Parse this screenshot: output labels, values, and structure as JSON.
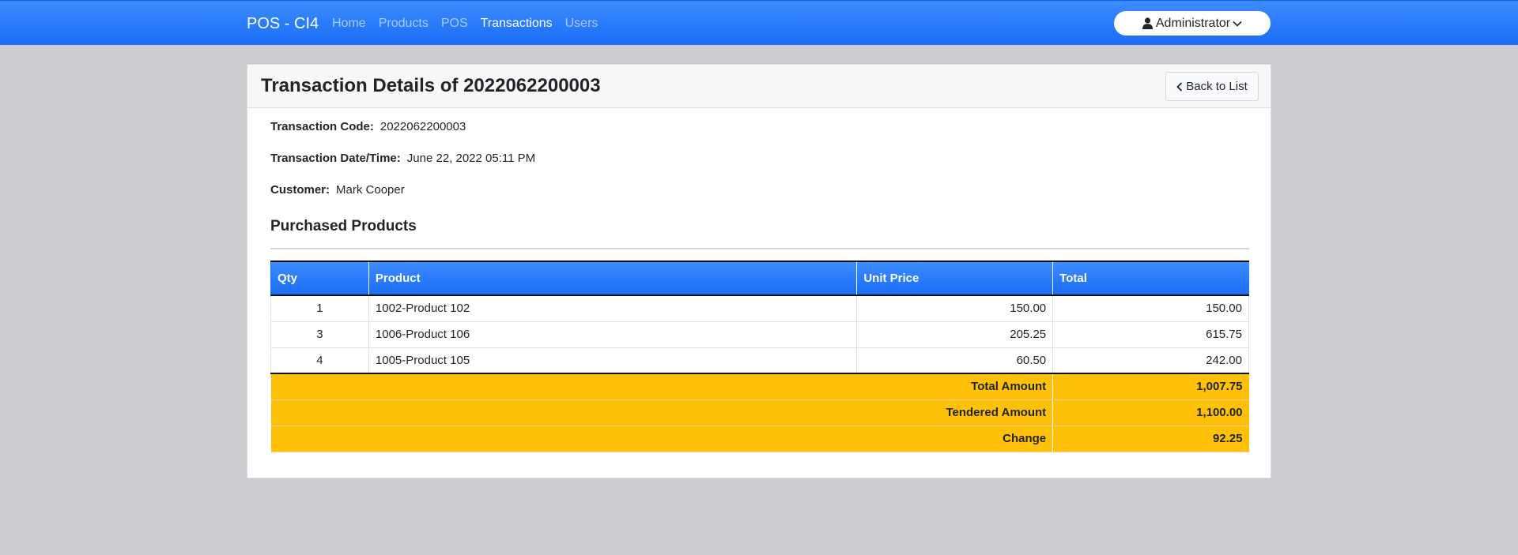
{
  "navbar": {
    "brand": "POS - CI4",
    "links": [
      {
        "label": "Home",
        "active": false
      },
      {
        "label": "Products",
        "active": false
      },
      {
        "label": "POS",
        "active": false
      },
      {
        "label": "Transactions",
        "active": true
      },
      {
        "label": "Users",
        "active": false
      }
    ],
    "user": {
      "label": "Administrator",
      "icon": "user-icon",
      "dropdown_icon": "chevron-down-icon"
    },
    "color": "#1a6df5"
  },
  "card": {
    "title": "Transaction Details of 2022062200003",
    "back_button": {
      "label": "Back to List",
      "icon": "chevron-left-icon"
    }
  },
  "details": {
    "code_label": "Transaction Code:",
    "code_value": "2022062200003",
    "datetime_label": "Transaction Date/Time:",
    "datetime_value": "June 22, 2022 05:11 PM",
    "customer_label": "Customer:",
    "customer_value": "Mark Cooper"
  },
  "products": {
    "section_title": "Purchased Products",
    "columns": [
      "Qty",
      "Product",
      "Unit Price",
      "Total"
    ],
    "rows": [
      {
        "qty": "1",
        "product": "1002-Product 102",
        "unit_price": "150.00",
        "total": "150.00"
      },
      {
        "qty": "3",
        "product": "1006-Product 106",
        "unit_price": "205.25",
        "total": "615.75"
      },
      {
        "qty": "4",
        "product": "1005-Product 105",
        "unit_price": "60.50",
        "total": "242.00"
      }
    ],
    "summary": [
      {
        "label": "Total Amount",
        "value": "1,007.75"
      },
      {
        "label": "Tendered Amount",
        "value": "1,100.00"
      },
      {
        "label": "Change",
        "value": "92.25"
      }
    ],
    "summary_color": "#ffc107"
  }
}
